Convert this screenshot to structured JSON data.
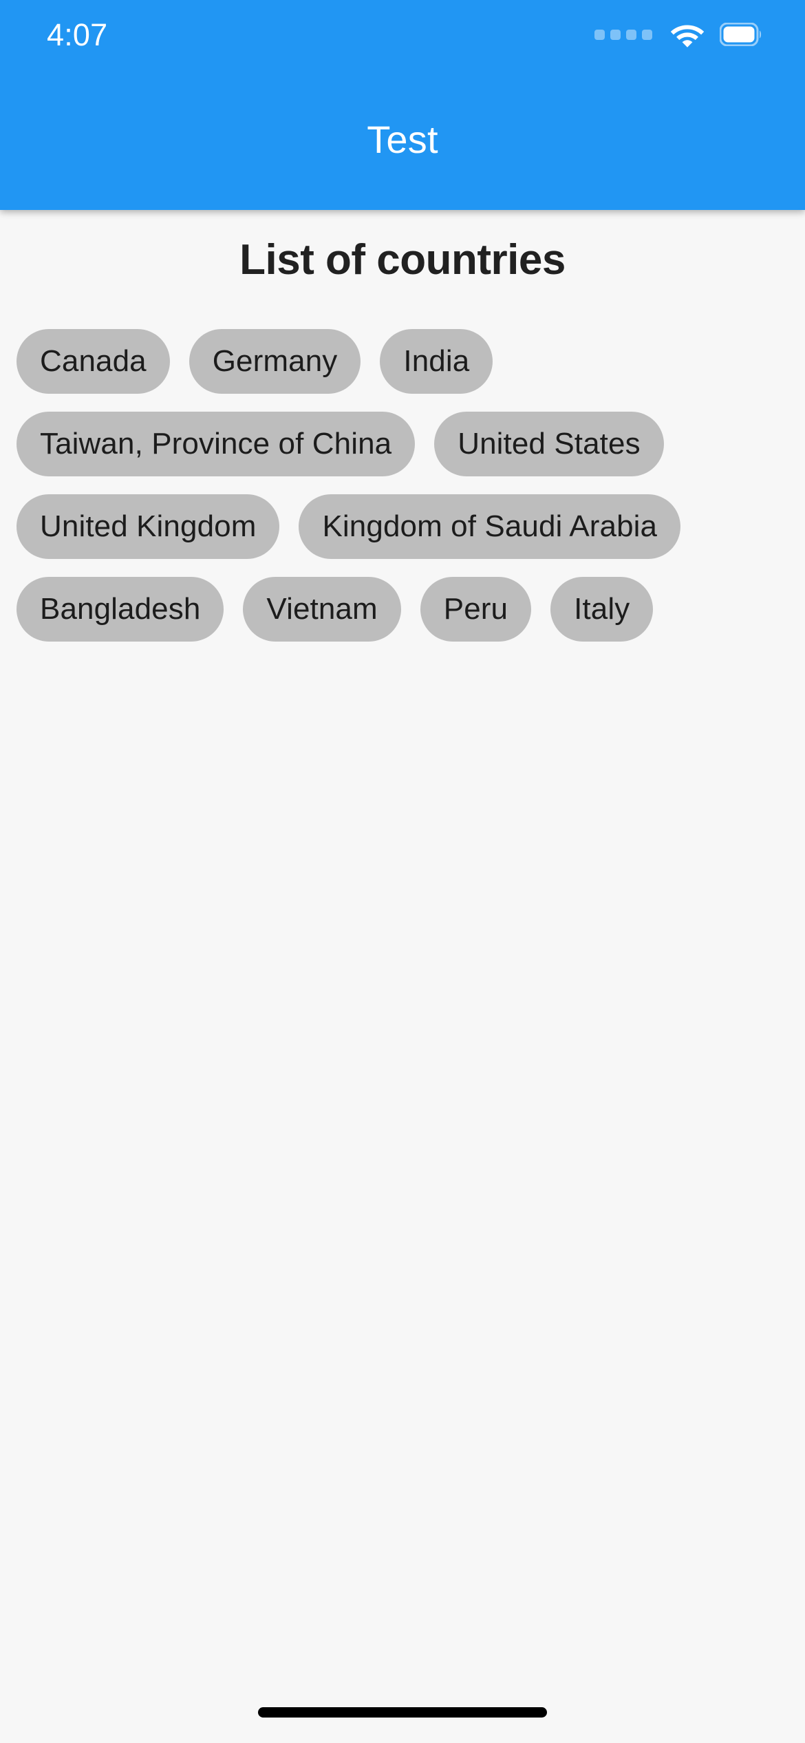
{
  "status_bar": {
    "time": "4:07",
    "signal_icon": "signal-dots-icon",
    "wifi_icon": "wifi-icon",
    "battery_icon": "battery-full-icon"
  },
  "app_bar": {
    "title": "Test",
    "background_color": "#2196F3",
    "title_color": "#FFFFFF"
  },
  "main": {
    "heading": "List of countries",
    "heading_color": "#212121",
    "background_color": "#F7F7F7",
    "chip_background_color": "#BDBDBD",
    "chip_text_color": "#1C1C1C",
    "countries": [
      "Canada",
      "Germany",
      "India",
      "Taiwan, Province of China",
      "United States",
      "United Kingdom",
      "Kingdom of Saudi Arabia",
      "Bangladesh",
      "Vietnam",
      "Peru",
      "Italy"
    ]
  },
  "system_nav": {
    "home_indicator": "home-indicator"
  }
}
